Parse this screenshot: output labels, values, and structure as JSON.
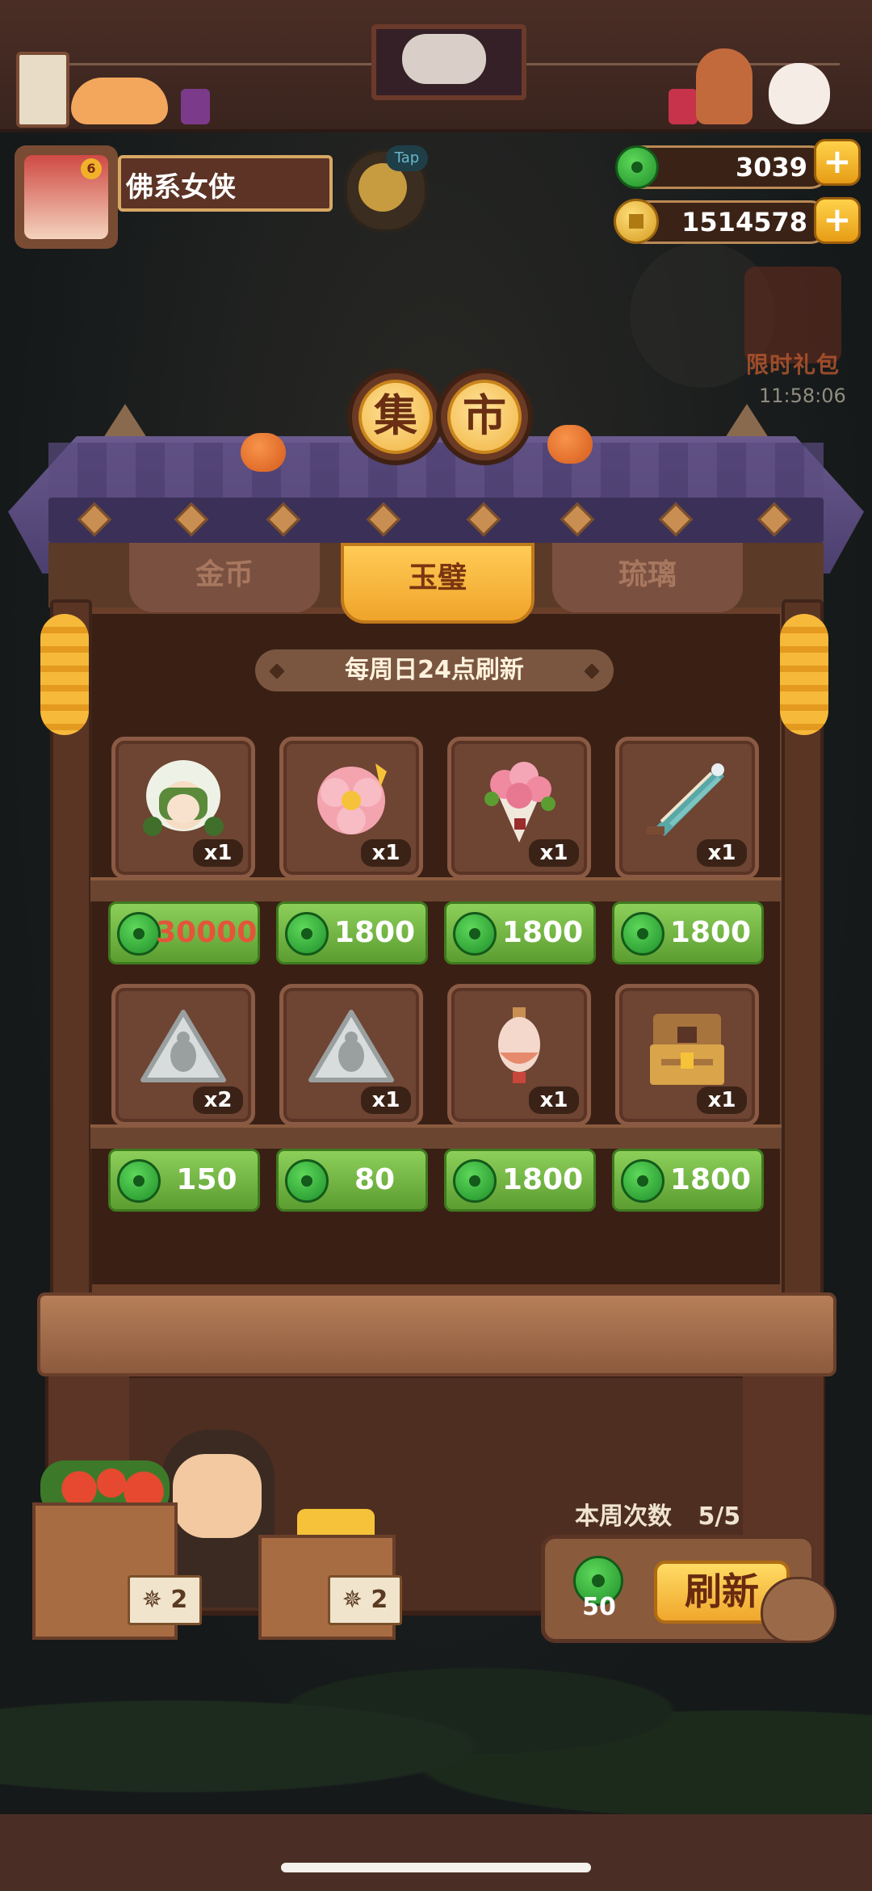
{
  "player": {
    "name": "佛系女侠",
    "badge": "6"
  },
  "currency": {
    "jade": "3039",
    "coins": "1514578",
    "add_symbol": "+"
  },
  "tap_hint": "Tap",
  "promo": {
    "label": "限时礼包",
    "timer": "11:58:06"
  },
  "market": {
    "title_chars": [
      "集",
      "市"
    ],
    "tabs": [
      {
        "label": "金币",
        "active": false
      },
      {
        "label": "玉璧",
        "active": true
      },
      {
        "label": "琉璃",
        "active": false
      }
    ],
    "refresh_note": "每周日24点刷新",
    "items": [
      {
        "name": "green-hair-doll",
        "qty": "x1",
        "price": "30000",
        "price_red": true
      },
      {
        "name": "pink-flower",
        "qty": "x1",
        "price": "1800"
      },
      {
        "name": "rose-bouquet",
        "qty": "x1",
        "price": "1800"
      },
      {
        "name": "paper-umbrella",
        "qty": "x1",
        "price": "1800"
      },
      {
        "name": "silver-bug-token",
        "qty": "x2",
        "price": "150"
      },
      {
        "name": "silver-bug-token",
        "qty": "x1",
        "price": "80"
      },
      {
        "name": "red-lantern",
        "qty": "x1",
        "price": "1800"
      },
      {
        "name": "treasure-chest",
        "qty": "x1",
        "price": "1800"
      }
    ]
  },
  "stall": {
    "tag_left": "✵ 2",
    "tag_right": "✵ 2"
  },
  "weekly": {
    "label": "本周次数",
    "count": "5/5",
    "refresh_cost": "50",
    "refresh_label": "刷新"
  }
}
